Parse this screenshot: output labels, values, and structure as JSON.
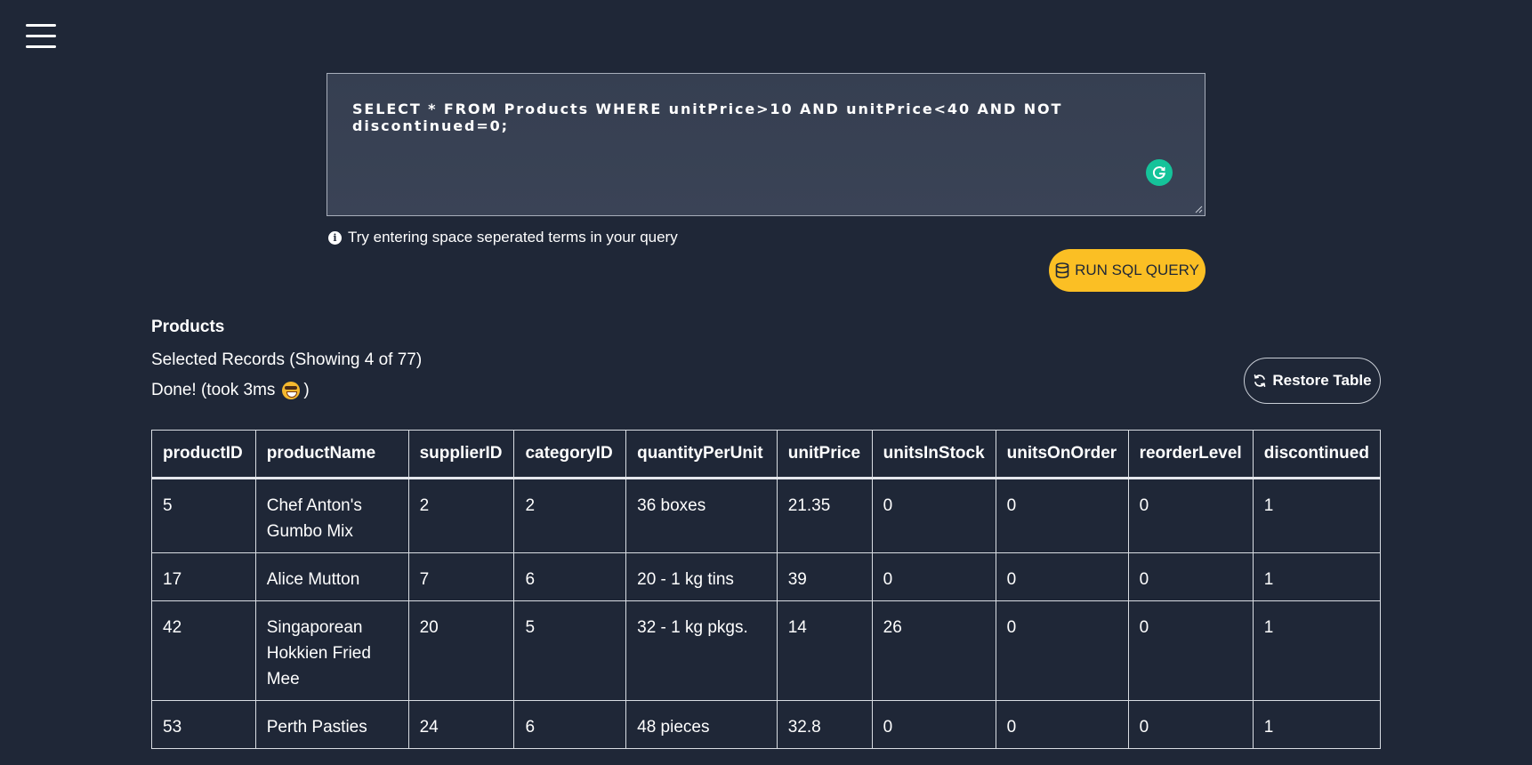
{
  "editor": {
    "query": "SELECT * FROM Products WHERE unitPrice>10 AND unitPrice<40 AND NOT discontinued=0;"
  },
  "hint": {
    "text": "Try entering space seperated terms in your query"
  },
  "run_button": {
    "label": "RUN SQL QUERY"
  },
  "results": {
    "table_name": "Products",
    "records_text": "Selected Records (Showing 4 of 77)",
    "status_text": "Done! (took 3ms",
    "status_close": ")",
    "restore_label": "Restore Table"
  },
  "table": {
    "columns": [
      "productID",
      "productName",
      "supplierID",
      "categoryID",
      "quantityPerUnit",
      "unitPrice",
      "unitsInStock",
      "unitsOnOrder",
      "reorderLevel",
      "discontinued"
    ],
    "rows": [
      [
        "5",
        "Chef Anton's Gumbo Mix",
        "2",
        "2",
        "36 boxes",
        "21.35",
        "0",
        "0",
        "0",
        "1"
      ],
      [
        "17",
        "Alice Mutton",
        "7",
        "6",
        "20 - 1 kg tins",
        "39",
        "0",
        "0",
        "0",
        "1"
      ],
      [
        "42",
        "Singaporean Hokkien Fried Mee",
        "20",
        "5",
        "32 - 1 kg pkgs.",
        "14",
        "26",
        "0",
        "0",
        "1"
      ],
      [
        "53",
        "Perth Pasties",
        "24",
        "6",
        "48 pieces",
        "32.8",
        "0",
        "0",
        "0",
        "1"
      ]
    ]
  },
  "icons": {
    "menu": "hamburger-icon",
    "grammarly": "grammarly-icon",
    "info": "info-icon",
    "database": "database-icon",
    "restore": "refresh-icon"
  },
  "colors": {
    "background": "#1f2737",
    "run_button": "#fbbf24",
    "grammarly": "#15c39a"
  }
}
